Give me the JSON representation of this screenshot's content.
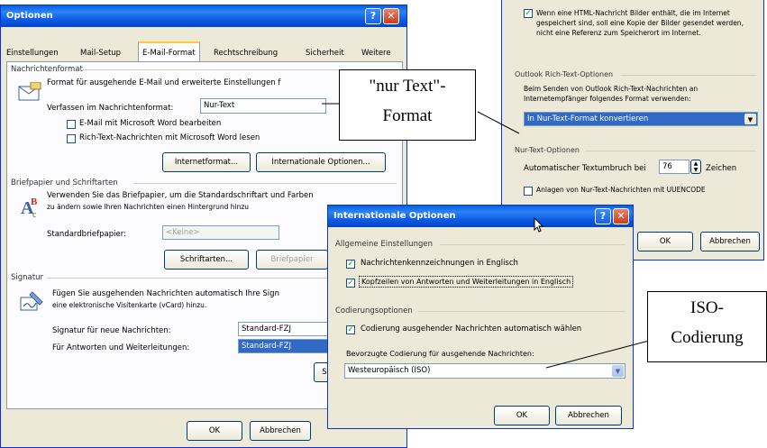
{
  "options_window": {
    "title": "Optionen",
    "help_btn": "?",
    "close_btn": "✕",
    "tabs": [
      "Einstellungen",
      "Mail-Setup",
      "E-Mail-Format",
      "Rechtschreibung",
      "Sicherheit",
      "Weitere"
    ],
    "message_format": {
      "group": "Nachrichtenformat",
      "desc": "Format für ausgehende E-Mail und erweiterte Einstellungen f",
      "compose_label": "Verfassen im Nachrichtenformat:",
      "compose_value": "Nur-Text",
      "word_edit": "E-Mail mit Microsoft Word bearbeiten",
      "word_read": "Rich-Text-Nachrichten mit Microsoft Word lesen",
      "internet_format_btn": "Internetformat...",
      "intl_options_btn": "Internationale Optionen..."
    },
    "stationery": {
      "group": "Briefpapier und Schriftarten",
      "desc1": "Verwenden Sie das Briefpapier, um die Standardschriftart und Farben",
      "desc2": "zu ändern sowie Ihren Nachrichten einen Hintergrund hinzu",
      "default_label": "Standardbriefpapier:",
      "default_value": "<Keine>",
      "fonts_btn": "Schriftarten...",
      "stationery_btn": "Briefpapier"
    },
    "signature": {
      "group": "Signatur",
      "desc1": "Fügen Sie ausgehenden Nachrichten automatisch Ihre Sign",
      "desc2": "eine elektronische Visitenkarte (vCard) hinzu.",
      "new_label": "Signatur für neue Nachrichten:",
      "new_value": "Standard-FZJ",
      "reply_label": "Für Antworten und Weiterleitungen:",
      "reply_value": "Standard-FZJ",
      "sig_btn": "S"
    },
    "ok_btn": "OK",
    "cancel_btn": "Abbrechen"
  },
  "back_window": {
    "html_pictures": "Wenn eine HTML-Nachricht Bilder enthält, die im Internet gespeichert sind, soll eine Kopie der Bilder gesendet werden, nicht eine Referenz zum Speicherort im Internet.",
    "richtext_group": "Outlook Rich-Text-Optionen",
    "richtext_desc": "Beim Senden von Outlook Rich-Text-Nachrichten an Internetempfänger folgendes Format verwenden:",
    "richtext_value": "In Nur-Text-Format konvertieren",
    "plaintext_group": "Nur-Text-Optionen",
    "wrap_label": "Automatischer Textumbruch bei",
    "wrap_value": "76",
    "wrap_unit": "Zeichen",
    "uuencode": "Anlagen von Nur-Text-Nachrichten mit UUENCODE",
    "ok_btn": "OK",
    "cancel_btn": "Abbrechen"
  },
  "intl_window": {
    "title": "Internationale Optionen",
    "help_btn": "?",
    "close_btn": "✕",
    "general_group": "Allgemeine Einstellungen",
    "english_flags": "Nachrichtenkennzeichnungen in Englisch",
    "english_headers": "Kopfzeilen von Antworten und Weiterleitungen in Englisch",
    "encoding_group": "Codierungsoptionen",
    "auto_encoding": "Codierung ausgehender Nachrichten automatisch wählen",
    "preferred_label": "Bevorzugte Codierung für ausgehende Nachrichten:",
    "preferred_value": "Westeuropäisch (ISO)",
    "ok_btn": "OK",
    "cancel_btn": "Abbrechen"
  },
  "callouts": {
    "nur_text_line1": "\"nur Text\"-",
    "nur_text_line2": "Format",
    "iso_line1": "ISO-",
    "iso_line2": "Codierung"
  },
  "colors": {
    "titlebar": "#0a5fe6",
    "dialog_face": "#ece9d8",
    "selection": "#316ac5"
  }
}
